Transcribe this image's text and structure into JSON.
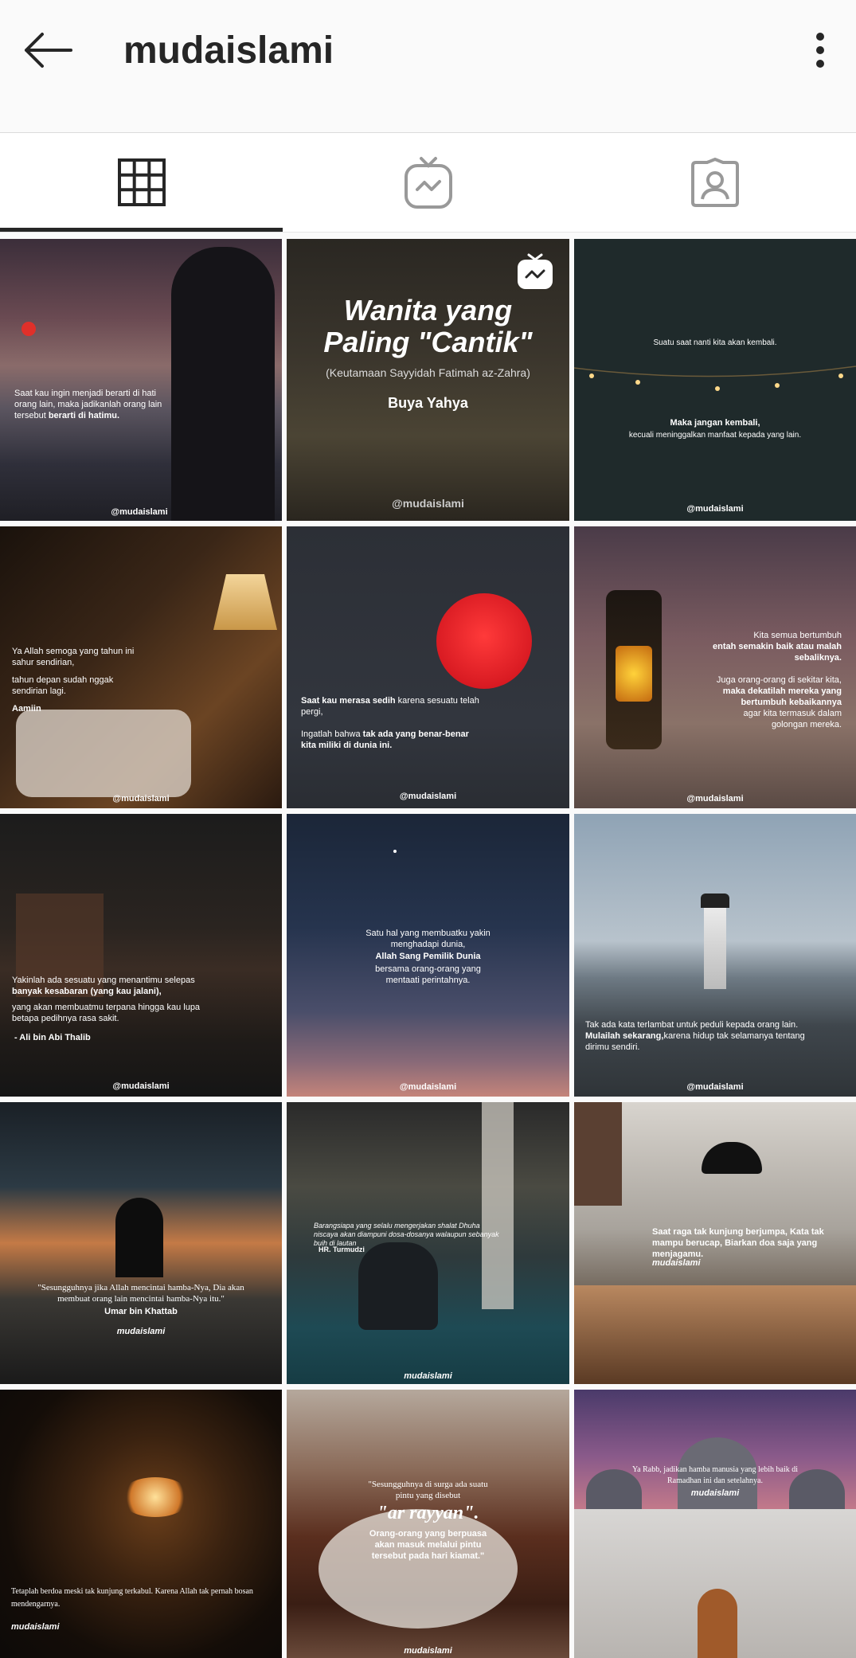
{
  "header": {
    "title": "mudaislami"
  },
  "tabs": [
    {
      "icon": "grid-icon",
      "active": true
    },
    {
      "icon": "igtv-icon",
      "active": false
    },
    {
      "icon": "tagged-icon",
      "active": false
    }
  ],
  "posts": [
    {
      "p1": "Saat kau ingin menjadi berarti di hati orang lain, maka jadikanlah orang lain tersebut ",
      "p1b": "berarti di hatimu.",
      "wm": "@mudaislami"
    },
    {
      "title1": "Wanita yang",
      "title2": "Paling \"Cantik\"",
      "sub": "(Keutamaan Sayyidah Fatimah az-Zahra)",
      "author": "Buya Yahya",
      "wm": "@mudaislami"
    },
    {
      "p1": "Suatu saat nanti kita akan kembali.",
      "p2b": "Maka jangan kembali,",
      "p3": "kecuali meninggalkan manfaat kepada yang lain.",
      "wm": "@mudaislami"
    },
    {
      "p1": "Ya Allah semoga yang tahun ini sahur sendirian,",
      "p2": "tahun depan sudah nggak sendirian lagi.",
      "p3b": "Aamiin",
      "wm": "@mudaislami"
    },
    {
      "p1b": "Saat kau merasa sedih",
      "p1": " karena sesuatu telah pergi,",
      "p2": "Ingatlah bahwa ",
      "p2b": "tak ada yang benar-benar kita miliki di dunia ini.",
      "wm": "@mudaislami"
    },
    {
      "p1": "Kita semua bertumbuh",
      "p1b": "entah semakin baik atau malah sebaliknya.",
      "p2": "Juga orang-orang di sekitar kita,",
      "p2b": "maka dekatilah mereka yang bertumbuh kebaikannya",
      "p3": "agar kita termasuk dalam golongan mereka.",
      "wm": "@mudaislami"
    },
    {
      "p1": "Yakinlah ada sesuatu yang menantimu selepas",
      "p1b": "banyak kesabaran (yang kau jalani),",
      "p2": "yang akan membuatmu terpana hingga kau lupa betapa pedihnya rasa sakit.",
      "p3b": "- Ali bin Abi Thalib",
      "wm": "@mudaislami"
    },
    {
      "p1": "Satu hal yang membuatku yakin menghadapi  dunia,",
      "p1b": "Allah Sang Pemilik Dunia",
      "p2": "bersama orang-orang yang mentaati perintahnya.",
      "wm": "@mudaislami"
    },
    {
      "p1": "Tak ada kata terlambat untuk peduli kepada orang lain.",
      "p1b": "Mulailah sekarang,",
      "p2": "karena hidup tak selamanya tentang dirimu sendiri.",
      "wm": "@mudaislami"
    },
    {
      "p1": "\"Sesungguhnya jika Allah mencintai hamba-Nya, Dia akan membuat orang lain mencintai hamba-Nya itu.\"",
      "p1b": "Umar bin Khattab",
      "wm": "mudaislami"
    },
    {
      "p1": "Barangsiapa yang selalu mengerjakan shalat Dhuha niscaya akan diampuni dosa-dosanya walaupun sebanyak buih di lautan",
      "p1b": "HR. Turmudzi",
      "wm": "mudaislami"
    },
    {
      "p1b": "Saat raga tak kunjung berjumpa, Kata tak mampu berucap, Biarkan doa saja yang menjagamu.",
      "wm": "mudaislami"
    },
    {
      "p1": "Tetaplah berdoa meski tak kunjung terkabul. Karena Allah tak pernah bosan mendengarnya.",
      "wm": "mudaislami"
    },
    {
      "p1": "\"Sesungguhnya di surga ada suatu pintu yang disebut",
      "big": "\"ar rayyan\".",
      "p1b": "Orang-orang yang berpuasa akan masuk melalui pintu tersebut pada hari kiamat.\"",
      "wm": "mudaislami"
    },
    {
      "p1": "Ya Rabb, jadikan hamba manusia yang lebih baik di Ramadhan ini dan setelahnya.",
      "wm": "mudaislami"
    }
  ]
}
